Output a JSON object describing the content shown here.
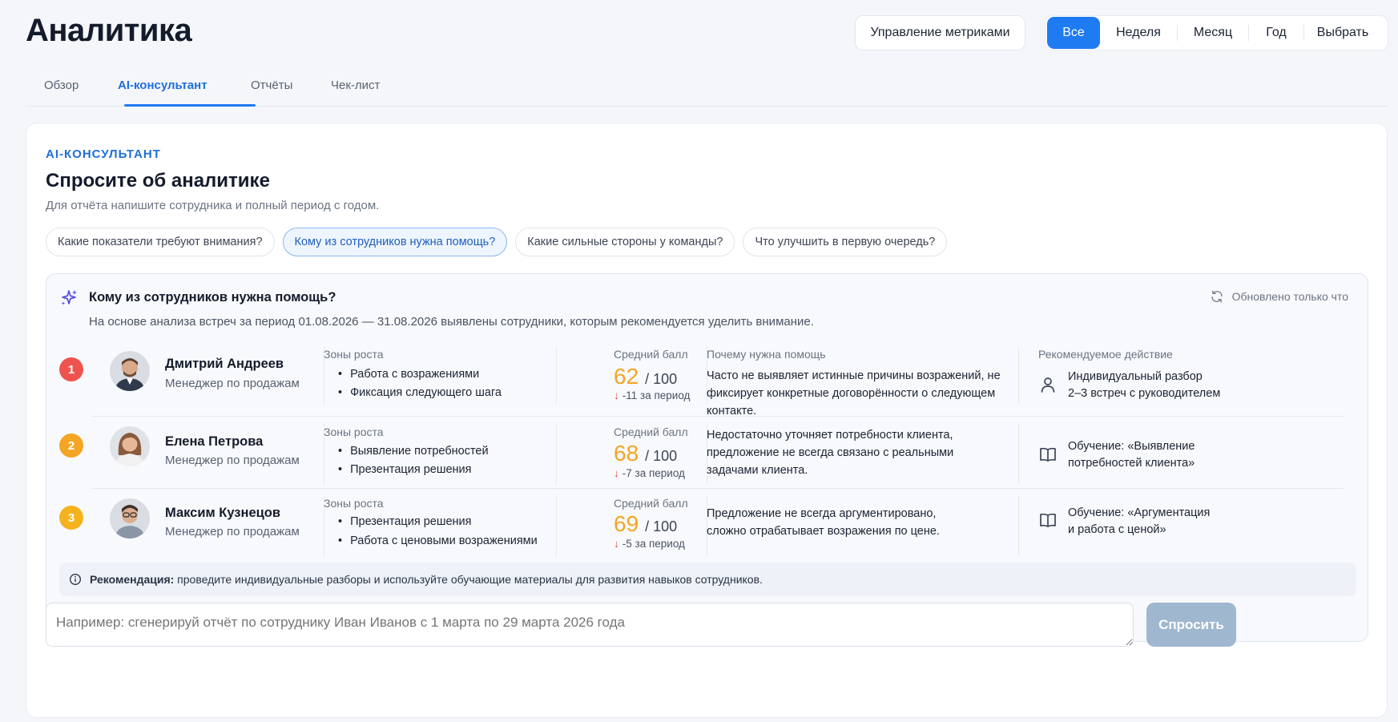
{
  "header": {
    "title": "Аналитика",
    "metrics_button": "Управление метриками",
    "periods": [
      "Все",
      "Неделя",
      "Месяц",
      "Год",
      "Выбрать"
    ],
    "active_period": "Все"
  },
  "tabs": [
    "Обзор",
    "AI-консультант",
    "Отчёты",
    "Чек-лист"
  ],
  "active_tab": "AI-консультант",
  "consultant": {
    "eyebrow": "AI-КОНСУЛЬТАНТ",
    "title": "Спросите об аналитике",
    "subtitle": "Для отчёта напишите сотрудника и полный период с годом.",
    "chips": [
      "Какие показатели требуют внимания?",
      "Кому из сотрудников нужна помощь?",
      "Какие сильные стороны у команды?",
      "Что улучшить в первую очередь?"
    ],
    "active_chip": "Кому из сотрудников нужна помощь?",
    "answer": {
      "title": "Кому из сотрудников нужна помощь?",
      "updated": "Обновлено только что",
      "intro": "На основе анализа встреч за период 01.08.2026 — 31.08.2026 выявлены сотрудники, которым рекомендуется уделить внимание.",
      "labels": {
        "growth": "Зоны роста",
        "avg": "Средний балл",
        "why": "Почему нужна помощь",
        "action": "Рекомендуемое действие"
      },
      "employees": [
        {
          "rank": "1",
          "rank_color": "#ef5350",
          "name": "Дмитрий Андреев",
          "role": "Менеджер по продажам",
          "growth": [
            "Работа с возражениями",
            "Фиксация следующего шага"
          ],
          "score": "62",
          "score_max": "/ 100",
          "delta": "-11 за период",
          "reason": "Часто не выявляет истинные причины возражений, не фиксирует конкретные договорённости о следующем контакте.",
          "action_icon": "person-icon",
          "action": "Индивидуальный разбор\n2–3 встреч с руководителем"
        },
        {
          "rank": "2",
          "rank_color": "#f5a524",
          "name": "Елена Петрова",
          "role": "Менеджер по продажам",
          "growth": [
            "Выявление потребностей",
            "Презентация решения"
          ],
          "score": "68",
          "score_max": "/ 100",
          "delta": "-7 за период",
          "reason": "Недостаточно уточняет потребности клиента, предложение не всегда связано с реальными задачами клиента.",
          "action_icon": "book-icon",
          "action": "Обучение: «Выявление\nпотребностей клиента»"
        },
        {
          "rank": "3",
          "rank_color": "#f5b21c",
          "name": "Максим Кузнецов",
          "role": "Менеджер по продажам",
          "growth": [
            "Презентация решения",
            "Работа с ценовыми возражениями"
          ],
          "score": "69",
          "score_max": "/ 100",
          "delta": "-5 за период",
          "reason": "Предложение не всегда аргументировано, сложно отрабатывает возражения по цене.",
          "action_icon": "book-icon",
          "action": "Обучение: «Аргументация\nи работа с ценой»"
        }
      ],
      "recommendation_label": "Рекомендация:",
      "recommendation_text": "проведите индивидуальные разборы и используйте обучающие материалы для развития навыков сотрудников."
    },
    "input_placeholder": "Например: сгенерируй отчёт по сотруднику Иван Иванов с 1 марта по 29 марта 2026 года",
    "ask_button": "Спросить"
  }
}
